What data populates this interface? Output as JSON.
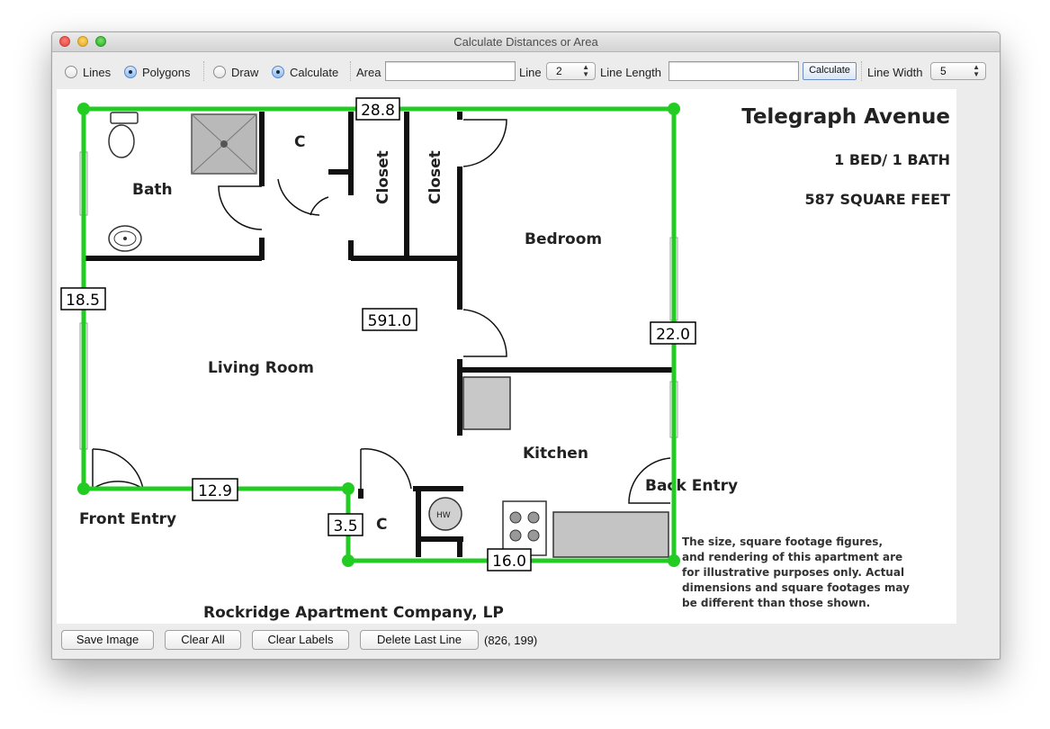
{
  "window": {
    "title": "Calculate Distances or Area"
  },
  "toolbar": {
    "mode_lines": "Lines",
    "mode_polygons": "Polygons",
    "action_draw": "Draw",
    "action_calculate": "Calculate",
    "area_label": "Area",
    "area_value": "",
    "line_label": "Line",
    "line_value": "2",
    "line_length_label": "Line Length",
    "line_length_value": "",
    "calculate_button": "Calculate",
    "line_width_label": "Line Width",
    "line_width_value": "5",
    "selected_mode": "Polygons",
    "selected_action": "Calculate"
  },
  "floorplan": {
    "title": "Telegraph Avenue",
    "beds": "1 BED/ 1 BATH",
    "sqft": "587 SQUARE FEET",
    "rooms": {
      "bath": "Bath",
      "c_top": "C",
      "closet1": "Closet",
      "closet2": "Closet",
      "bedroom": "Bedroom",
      "living": "Living Room",
      "kitchen": "Kitchen",
      "back_entry": "Back Entry",
      "front_entry": "Front Entry",
      "c_bottom": "C",
      "hw": "HW"
    },
    "company": "Rockridge Apartment Company, LP",
    "disclaimer": [
      "The size, square footage figures,",
      "and rendering of this apartment are",
      "for illustrative purposes only. Actual",
      "dimensions and square footages may",
      "be different than those shown."
    ]
  },
  "measurements": {
    "top": "28.8",
    "left": "18.5",
    "area": "591.0",
    "right": "22.0",
    "front": "12.9",
    "step": "3.5",
    "bottom": "16.0"
  },
  "colors": {
    "polygon_line": "#22cc22"
  },
  "bottom": {
    "save_image": "Save Image",
    "clear_all": "Clear All",
    "clear_labels": "Clear Labels",
    "delete_last_line": "Delete Last Line",
    "cursor_coords": "(826, 199)"
  }
}
